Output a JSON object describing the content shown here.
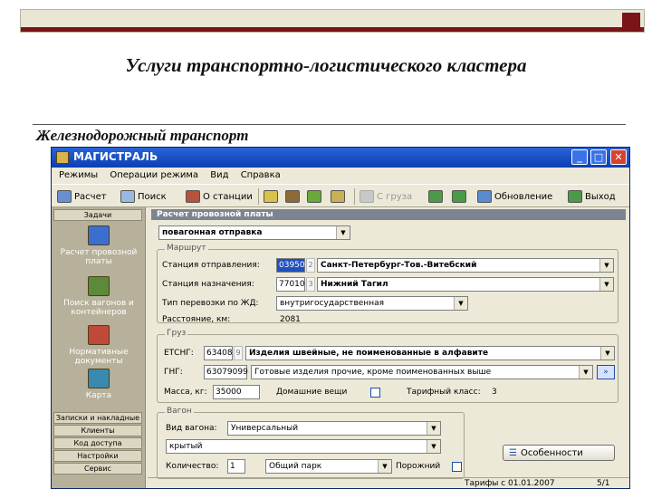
{
  "slide": {
    "title": "Услуги транспортно-логистического кластера",
    "subtitle": "Железнодорожный транспорт"
  },
  "window": {
    "title": "МАГИСТРАЛЬ",
    "controls": {
      "minimize": "_",
      "maximize": "□",
      "close": "✕"
    }
  },
  "menu": [
    "Режимы",
    "Операции режима",
    "Вид",
    "Справка"
  ],
  "toolbar": {
    "calc": "Расчет",
    "search": "Поиск",
    "station": "О станции",
    "from_cargo": "С груза",
    "refresh": "Обновление",
    "exit": "Выход",
    "icons": [
      "calculator-icon",
      "search-icon",
      "station-icon",
      "tool-icon",
      "train-icon",
      "tool-icon",
      "tool-icon",
      "cargo-icon",
      "export-icon",
      "import-icon",
      "refresh-icon",
      "exit-icon"
    ]
  },
  "sidebar": {
    "header": "Задачи",
    "items": [
      {
        "label": "Расчет провозной платы",
        "icon": "calculator-icon",
        "color": "#3a6fd0"
      },
      {
        "label": "Поиск вагонов и контейнеров",
        "icon": "search-icon",
        "color": "#5b8a3a"
      },
      {
        "label": "Нормативные документы",
        "icon": "documents-icon",
        "color": "#c04a3a"
      },
      {
        "label": "Карта",
        "icon": "map-icon",
        "color": "#3a8ab0"
      }
    ],
    "links": [
      "Записки и накладные",
      "Клиенты",
      "Код доступа",
      "Настройки",
      "Сервис"
    ]
  },
  "form": {
    "panel_title": "Расчет провозной платы",
    "shipment_type": "повагонная отправка",
    "route": {
      "group_title": "Маршрут",
      "departure_label": "Станция отправления:",
      "departure_code": "03950",
      "departure_suffix": "2",
      "departure_name": "Санкт-Петербург-Тов.-Витебский",
      "destination_label": "Станция назначения:",
      "destination_code": "77010",
      "destination_suffix": "3",
      "destination_name": "Нижний Тагил",
      "transport_type_label": "Тип перевозки по ЖД:",
      "transport_type": "внутригосударственная",
      "distance_label": "Расстояние, км:",
      "distance": "2081"
    },
    "cargo": {
      "group_title": "Груз",
      "etsng_label": "ЕТСНГ:",
      "etsng_code": "63408",
      "etsng_suffix": "9",
      "etsng_name": "Изделия швейные, не поименованные в алфавите",
      "gng_label": "ГНГ:",
      "gng_code": "63079099",
      "gng_name": "Готовые изделия прочие, кроме поименованных выше",
      "gng_button": "»",
      "mass_label": "Масса, кг:",
      "mass": "35000",
      "household_label": "Домашние вещи",
      "tariff_class_label": "Тарифный класс:",
      "tariff_class": "3"
    },
    "wagon": {
      "group_title": "Вагон",
      "kind_label": "Вид вагона:",
      "kind": "Универсальный",
      "subtype": "крытый",
      "quantity_label": "Количество:",
      "quantity": "1",
      "park": "Общий парк",
      "empty_label": "Порожний"
    },
    "features_button": "Особенности",
    "status": {
      "tariffs": "Тарифы с 01.01.2007",
      "page": "5/1"
    }
  },
  "colors": {
    "slide_accent": "#7a1418",
    "titlebar": "#0b3fb3",
    "sidebar": "#b7b09a",
    "panel_header": "#7c8491"
  }
}
